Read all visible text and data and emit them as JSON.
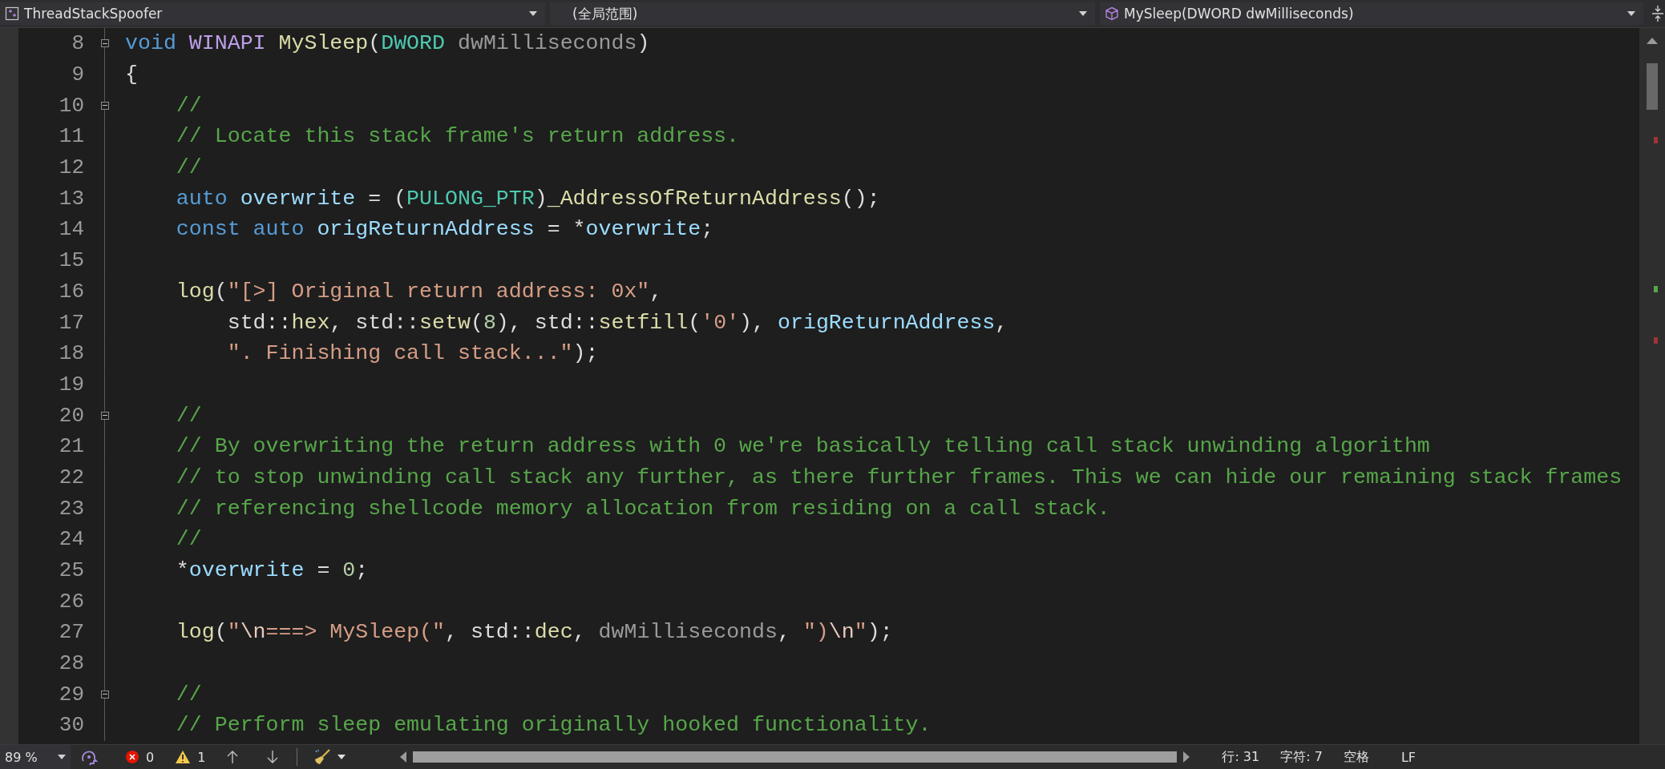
{
  "toolbar": {
    "project": "ThreadStackSpoofer",
    "scope": "(全局范围)",
    "member": "MySleep(DWORD dwMilliseconds)"
  },
  "lines": [
    {
      "number": "8",
      "collapsible": true,
      "tokens": [
        {
          "kind": "keyword",
          "text": "void"
        },
        {
          "kind": "macro",
          "text": " WINAPI"
        },
        {
          "kind": "function",
          "text": " MySleep"
        },
        {
          "kind": "plain",
          "text": "("
        },
        {
          "kind": "type",
          "text": "DWORD"
        },
        {
          "kind": "param",
          "text": " dwMilliseconds"
        },
        {
          "kind": "plain",
          "text": ")"
        }
      ]
    },
    {
      "number": "9",
      "collapsible": false,
      "tokens": [
        {
          "kind": "plain",
          "text": "{"
        }
      ]
    },
    {
      "number": "10",
      "collapsible": true,
      "tokens": [
        {
          "kind": "comment",
          "text": "    //"
        }
      ]
    },
    {
      "number": "11",
      "collapsible": false,
      "tokens": [
        {
          "kind": "comment",
          "text": "    // Locate this stack frame's return address."
        }
      ]
    },
    {
      "number": "12",
      "collapsible": false,
      "tokens": [
        {
          "kind": "comment",
          "text": "    //"
        }
      ]
    },
    {
      "number": "13",
      "collapsible": false,
      "tokens": [
        {
          "kind": "keyword",
          "text": "    auto"
        },
        {
          "kind": "variable",
          "text": " overwrite"
        },
        {
          "kind": "plain",
          "text": " = ("
        },
        {
          "kind": "type",
          "text": "PULONG_PTR"
        },
        {
          "kind": "plain",
          "text": ")"
        },
        {
          "kind": "function",
          "text": "_AddressOfReturnAddress"
        },
        {
          "kind": "plain",
          "text": "();"
        }
      ]
    },
    {
      "number": "14",
      "collapsible": false,
      "tokens": [
        {
          "kind": "keyword",
          "text": "    const auto"
        },
        {
          "kind": "variable",
          "text": " origReturnAddress"
        },
        {
          "kind": "plain",
          "text": " = *"
        },
        {
          "kind": "variable",
          "text": "overwrite"
        },
        {
          "kind": "plain",
          "text": ";"
        }
      ]
    },
    {
      "number": "15",
      "collapsible": false
    },
    {
      "number": "16",
      "collapsible": false,
      "tokens": [
        {
          "kind": "function",
          "text": "    log"
        },
        {
          "kind": "plain",
          "text": "("
        },
        {
          "kind": "string",
          "text": "\"[>] Original return address: 0x\""
        },
        {
          "kind": "plain",
          "text": ","
        }
      ]
    },
    {
      "number": "17",
      "collapsible": false,
      "tokens": [
        {
          "kind": "plain",
          "text": "        std::"
        },
        {
          "kind": "function",
          "text": "hex"
        },
        {
          "kind": "plain",
          "text": ", std::"
        },
        {
          "kind": "function",
          "text": "setw"
        },
        {
          "kind": "plain",
          "text": "("
        },
        {
          "kind": "number",
          "text": "8"
        },
        {
          "kind": "plain",
          "text": "), std::"
        },
        {
          "kind": "function",
          "text": "setfill"
        },
        {
          "kind": "plain",
          "text": "("
        },
        {
          "kind": "string",
          "text": "'0'"
        },
        {
          "kind": "plain",
          "text": "), "
        },
        {
          "kind": "variable",
          "text": "origReturnAddress"
        },
        {
          "kind": "plain",
          "text": ","
        }
      ]
    },
    {
      "number": "18",
      "collapsible": false,
      "tokens": [
        {
          "kind": "string",
          "text": "        \". Finishing call stack...\""
        },
        {
          "kind": "plain",
          "text": ");"
        }
      ]
    },
    {
      "number": "19",
      "collapsible": false
    },
    {
      "number": "20",
      "collapsible": true,
      "tokens": [
        {
          "kind": "comment",
          "text": "    //"
        }
      ]
    },
    {
      "number": "21",
      "collapsible": false,
      "tokens": [
        {
          "kind": "comment",
          "text": "    // By overwriting the return address with 0 we're basically telling call stack unwinding algorithm"
        }
      ]
    },
    {
      "number": "22",
      "collapsible": false,
      "tokens": [
        {
          "kind": "comment",
          "text": "    // to stop unwinding call stack any further, as there further frames. This we can hide our remaining stack frames"
        }
      ]
    },
    {
      "number": "23",
      "collapsible": false,
      "tokens": [
        {
          "kind": "comment",
          "text": "    // referencing shellcode memory allocation from residing on a call stack."
        }
      ]
    },
    {
      "number": "24",
      "collapsible": false,
      "tokens": [
        {
          "kind": "comment",
          "text": "    //"
        }
      ]
    },
    {
      "number": "25",
      "collapsible": false,
      "tokens": [
        {
          "kind": "plain",
          "text": "    *"
        },
        {
          "kind": "variable",
          "text": "overwrite"
        },
        {
          "kind": "plain",
          "text": " = "
        },
        {
          "kind": "number",
          "text": "0"
        },
        {
          "kind": "plain",
          "text": ";"
        }
      ]
    },
    {
      "number": "26",
      "collapsible": false
    },
    {
      "number": "27",
      "collapsible": false,
      "tokens": [
        {
          "kind": "function",
          "text": "    log"
        },
        {
          "kind": "plain",
          "text": "("
        },
        {
          "kind": "string",
          "text": "\""
        },
        {
          "kind": "escape",
          "text": "\\n"
        },
        {
          "kind": "string",
          "text": "===> MySleep(\""
        },
        {
          "kind": "plain",
          "text": ", std::"
        },
        {
          "kind": "function",
          "text": "dec"
        },
        {
          "kind": "plain",
          "text": ", "
        },
        {
          "kind": "param",
          "text": "dwMilliseconds"
        },
        {
          "kind": "plain",
          "text": ", "
        },
        {
          "kind": "string",
          "text": "\")"
        },
        {
          "kind": "escape",
          "text": "\\n"
        },
        {
          "kind": "string",
          "text": "\""
        },
        {
          "kind": "plain",
          "text": ");"
        }
      ]
    },
    {
      "number": "28",
      "collapsible": false
    },
    {
      "number": "29",
      "collapsible": true,
      "tokens": [
        {
          "kind": "comment",
          "text": "    //"
        }
      ]
    },
    {
      "number": "30",
      "collapsible": false,
      "tokens": [
        {
          "kind": "comment",
          "text": "    // Perform sleep emulating originally hooked functionality."
        }
      ]
    }
  ],
  "scrollbar_marks": [
    {
      "color": "#a1333a"
    },
    {
      "color": "#57a64a"
    },
    {
      "color": "#a1333a"
    }
  ],
  "status_bar": {
    "zoom": "89 %",
    "errors": "0",
    "warnings": "1",
    "line": "行: 31",
    "column": "字符: 7",
    "indent": "空格",
    "line_ending": "LF"
  }
}
